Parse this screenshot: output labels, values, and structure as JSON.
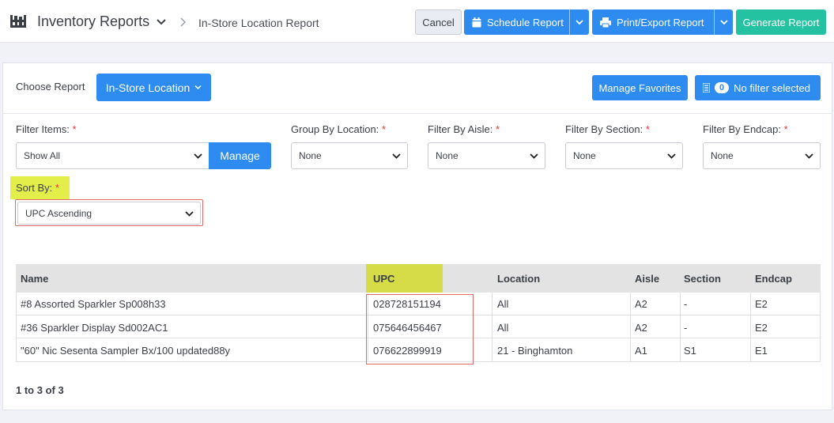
{
  "header": {
    "app_title": "Inventory Reports",
    "breadcrumb": "In-Store Location Report",
    "cancel_label": "Cancel",
    "schedule_label": "Schedule Report",
    "print_label": "Print/Export Report",
    "generate_label": "Generate Report"
  },
  "report": {
    "choose_label": "Choose Report",
    "type_label": "In-Store Location",
    "favorites_label": "Manage Favorites",
    "filter_count": "0",
    "filter_status": "No filter selected"
  },
  "filters": {
    "items": {
      "label": "Filter Items:",
      "value": "Show All",
      "manage_label": "Manage"
    },
    "group_by": {
      "label": "Group By Location:",
      "value": "None"
    },
    "aisle": {
      "label": "Filter By Aisle:",
      "value": "None"
    },
    "section": {
      "label": "Filter By Section:",
      "value": "None"
    },
    "endcap": {
      "label": "Filter By Endcap:",
      "value": "None"
    },
    "sort": {
      "label": "Sort By:",
      "value": "UPC Ascending"
    },
    "required_mark": "*"
  },
  "table": {
    "columns": [
      "Name",
      "UPC",
      "Location",
      "Aisle",
      "Section",
      "Endcap"
    ],
    "rows": [
      [
        "#8 Assorted Sparkler Sp008h33",
        "028728151194",
        "All",
        "A2",
        "-",
        "E2"
      ],
      [
        "#36 Sparkler Display Sd002AC1",
        "075646456467",
        "All",
        "A2",
        "-",
        "E2"
      ],
      [
        "\"60\" Nic Sesenta Sampler Bx/100 updated88y",
        "076622899919",
        "21 - Binghamton",
        "A1",
        "S1",
        "E1"
      ]
    ]
  },
  "pagination": {
    "summary": "1 to 3 of 3"
  },
  "colors": {
    "primary": "#2e8bef",
    "generate": "#24c2a0",
    "highlight": "#e4ee4a",
    "required": "#e53935",
    "annotation_outline": "#e06a6a"
  },
  "icons": {
    "app": "store-building-icon",
    "schedule": "calendar-icon",
    "print": "printer-icon",
    "filter": "filter-list-icon"
  }
}
